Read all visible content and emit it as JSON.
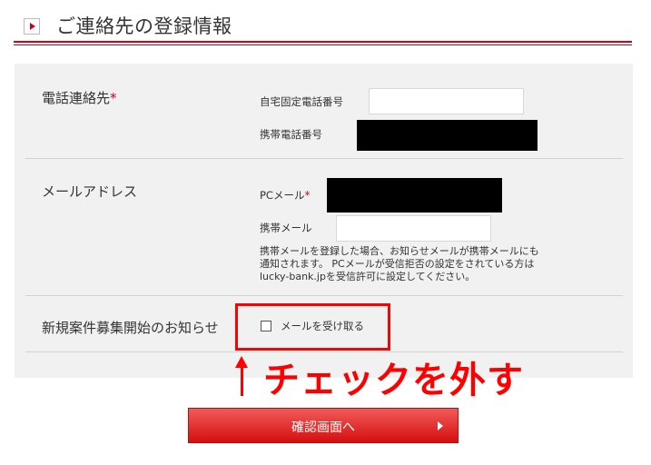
{
  "header": {
    "title": "ご連絡先の登録情報",
    "icon": "play-triangle-icon"
  },
  "form": {
    "phone_section": {
      "label": "電話連絡先",
      "required_mark": "*",
      "home_phone_label": "自宅固定電話番号",
      "home_phone_value": "",
      "mobile_phone_label": "携帯電話番号"
    },
    "email_section": {
      "label": "メールアドレス",
      "pc_email_label": "PCメール",
      "required_mark": "*",
      "mobile_email_label": "携帯メール",
      "mobile_email_value": "",
      "note_lines": [
        "携帯メールを登録した場合、お知らせメールが携帯メールにも",
        "通知されます。 PCメールが受信拒否の設定をされている方は",
        "lucky-bank.jpを受信許可に設定してください。"
      ]
    },
    "notify_section": {
      "label": "新規案件募集開始のお知らせ",
      "checkbox_label": "メールを受け取る",
      "checked": false
    }
  },
  "annotation": {
    "text": "チェックを外す",
    "color": "#ff0000"
  },
  "submit": {
    "label": "確認画面へ"
  },
  "colors": {
    "accent": "#d0021b",
    "panel": "#f1f1f1"
  }
}
